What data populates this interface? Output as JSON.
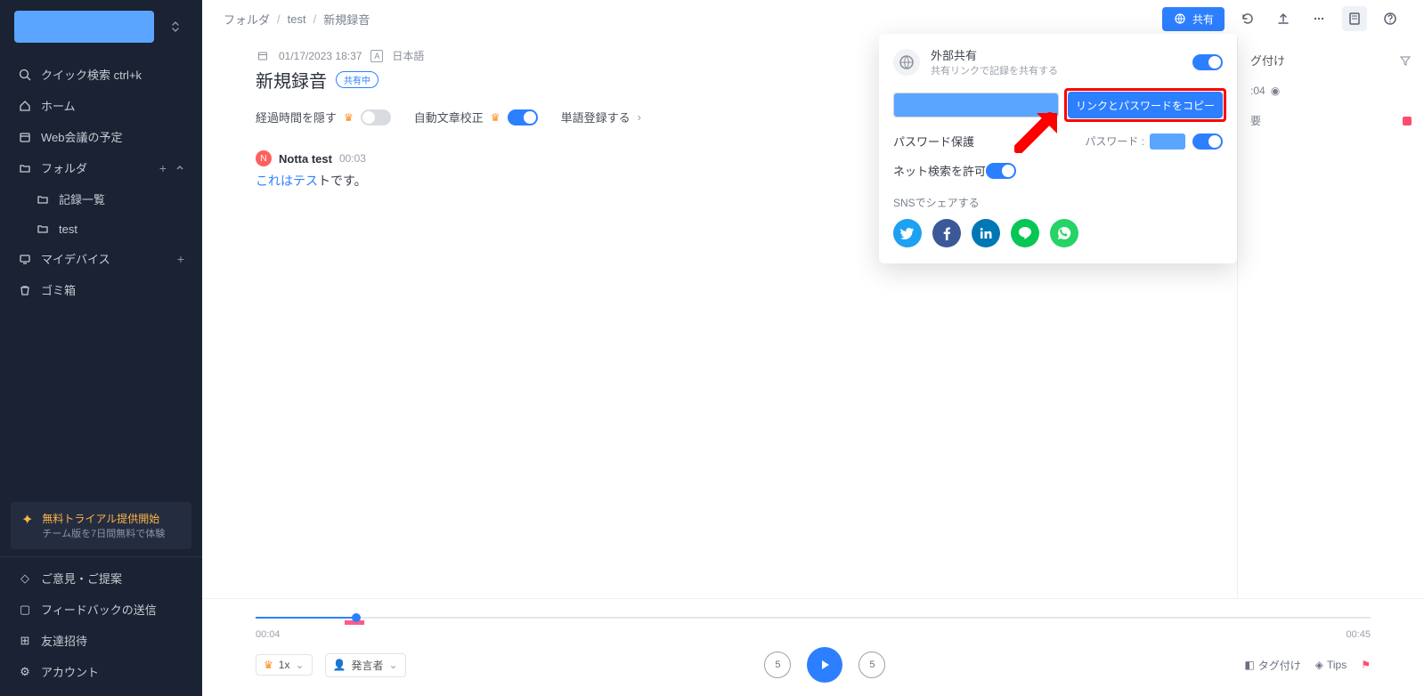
{
  "sidebar": {
    "quick_search": "クイック検索 ctrl+k",
    "home": "ホーム",
    "meetings": "Web会議の予定",
    "folder": "フォルダ",
    "records": "記録一覧",
    "test": "test",
    "mydevice": "マイデバイス",
    "trash": "ゴミ箱",
    "trial_title": "無料トライアル提供開始",
    "trial_sub": "チーム版を7日間無料で体験",
    "feedback1": "ご意見・ご提案",
    "feedback2": "フィードバックの送信",
    "invite": "友達招待",
    "account": "アカウント"
  },
  "breadcrumbs": {
    "a": "フォルダ",
    "b": "test",
    "c": "新規録音"
  },
  "topbar": {
    "share": "共有"
  },
  "meta": {
    "datetime": "01/17/2023 18:37",
    "lang": "日本語"
  },
  "title": "新規録音",
  "sharing_badge": "共有中",
  "options": {
    "hide_elapsed": "経過時間を隠す",
    "auto_proof": "自動文章校正",
    "word_register": "単語登録する"
  },
  "segment": {
    "initial": "N",
    "name": "Notta test",
    "time": "00:03",
    "text_hl": "これはテス",
    "text_rest": "トです。"
  },
  "right": {
    "title": "グ付け",
    "row_time": ":04",
    "row_text": "要"
  },
  "popover": {
    "ext_title": "外部共有",
    "ext_sub": "共有リンクで記録を共有する",
    "copy_btn": "リンクとパスワードをコピー",
    "pw_protect": "パスワード保護",
    "pw_label": "パスワード :",
    "search_allow": "ネット検索を許可",
    "sns_label": "SNSでシェアする"
  },
  "player": {
    "cur": "00:04",
    "dur": "00:45",
    "speed": "1x",
    "speaker": "発言者",
    "tag": "タグ付け",
    "tips": "Tips"
  }
}
